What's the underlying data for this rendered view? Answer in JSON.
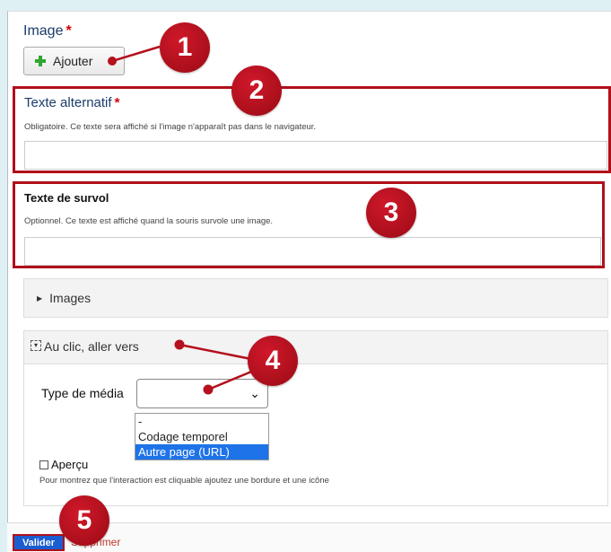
{
  "image_field": {
    "label": "Image",
    "required_mark": "*",
    "add_button": "Ajouter"
  },
  "alt_text": {
    "label": "Texte alternatif",
    "required_mark": "*",
    "help": "Obligatoire. Ce texte sera affiché si l'image n'apparaît pas dans le navigateur.",
    "value": ""
  },
  "hover_text": {
    "label": "Texte de survol",
    "help": "Optionnel. Ce texte est affiché quand la souris survole une image.",
    "value": ""
  },
  "accordion_images": {
    "label": "Images"
  },
  "accordion_click": {
    "label": "Au clic, aller vers",
    "media_type_label": "Type de média",
    "media_type_value": "",
    "options": [
      "-",
      "Codage temporel",
      "Autre page (URL)"
    ],
    "selected_option": "Autre page (URL)",
    "preview_label": "Aperçu",
    "preview_help": "Pour montrez que l'interaction est cliquable ajoutez une bordure et une icône"
  },
  "footer": {
    "validate_button": "Valider",
    "delete_link": "Supprimer"
  },
  "badges": [
    "1",
    "2",
    "3",
    "4",
    "5"
  ],
  "colors": {
    "badge": "#b5101d",
    "highlight_border": "#b0101a",
    "primary": "#1a5dd0",
    "add_icon": "#2fa72f"
  }
}
